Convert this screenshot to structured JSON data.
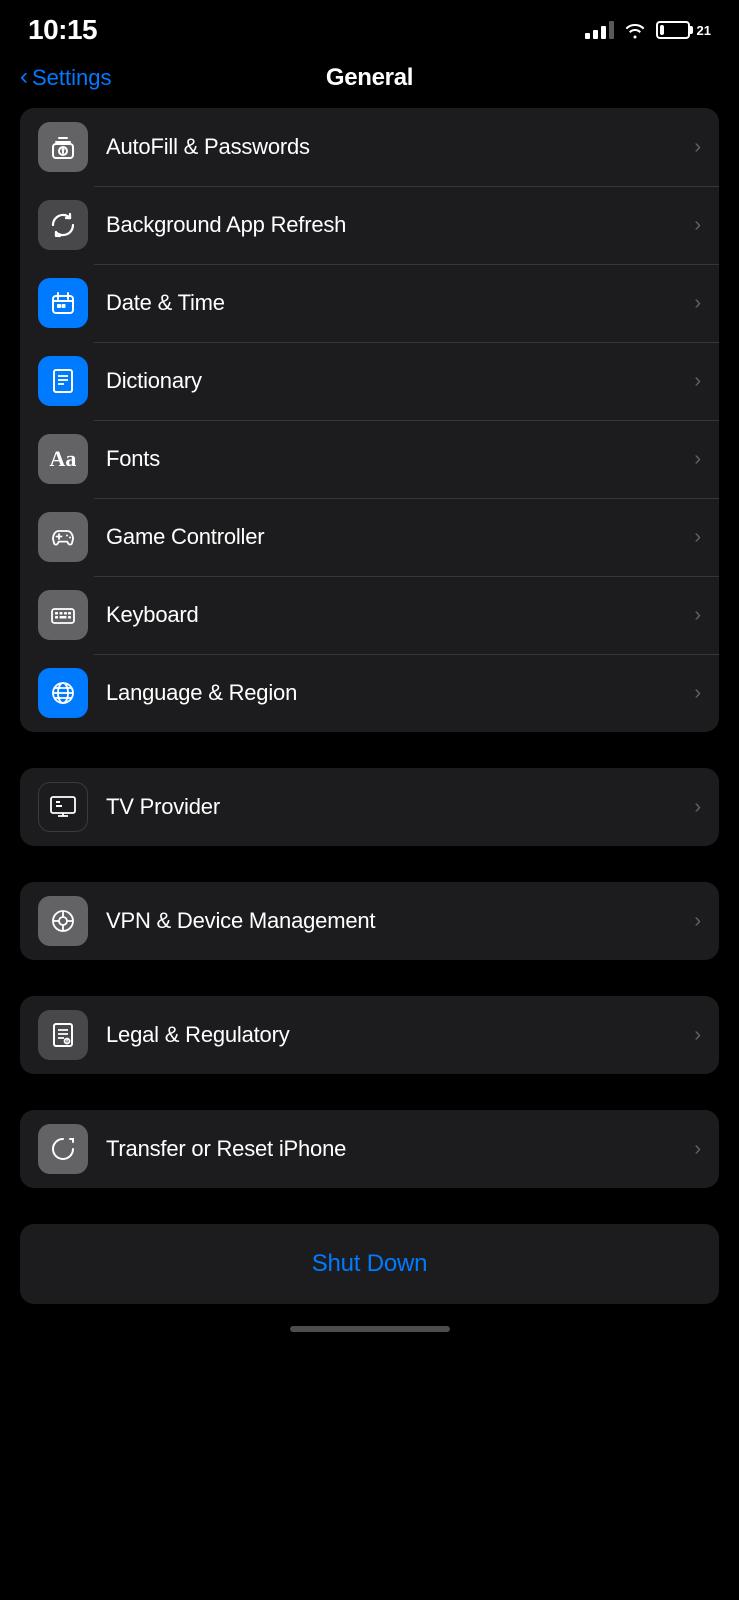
{
  "statusBar": {
    "time": "10:15",
    "battery": "21"
  },
  "header": {
    "backLabel": "Settings",
    "title": "General"
  },
  "mainGroup": {
    "items": [
      {
        "id": "autofill",
        "label": "AutoFill & Passwords",
        "iconColor": "gray",
        "iconType": "key"
      },
      {
        "id": "background-refresh",
        "label": "Background App Refresh",
        "iconColor": "dark-gray",
        "iconType": "refresh"
      },
      {
        "id": "date-time",
        "label": "Date & Time",
        "iconColor": "blue",
        "iconType": "datetime"
      },
      {
        "id": "dictionary",
        "label": "Dictionary",
        "iconColor": "blue",
        "iconType": "dictionary"
      },
      {
        "id": "fonts",
        "label": "Fonts",
        "iconColor": "gray",
        "iconType": "fonts"
      },
      {
        "id": "game-controller",
        "label": "Game Controller",
        "iconColor": "gray",
        "iconType": "gamepad"
      },
      {
        "id": "keyboard",
        "label": "Keyboard",
        "iconColor": "gray",
        "iconType": "keyboard"
      },
      {
        "id": "language-region",
        "label": "Language & Region",
        "iconColor": "blue",
        "iconType": "globe"
      }
    ]
  },
  "tvProviderGroup": {
    "label": "TV Provider",
    "iconColor": "black",
    "iconType": "tv"
  },
  "vpnGroup": {
    "label": "VPN & Device Management",
    "iconColor": "gray",
    "iconType": "gear"
  },
  "legalGroup": {
    "label": "Legal & Regulatory",
    "iconColor": "dark-gray",
    "iconType": "legal"
  },
  "transferGroup": {
    "label": "Transfer or Reset iPhone",
    "iconColor": "gray",
    "iconType": "transfer"
  },
  "shutdownGroup": {
    "label": "Shut Down"
  }
}
